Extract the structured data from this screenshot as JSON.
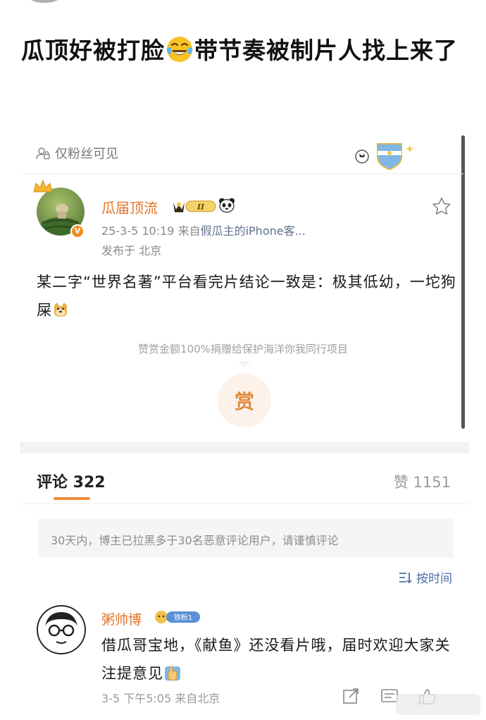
{
  "headline": {
    "part1": "瓜顶好被打脸",
    "emoji": "face-with-tears-of-joy",
    "part2": "带节奏被制片人找上来了"
  },
  "post": {
    "visibility": "仅粉丝可见",
    "author": {
      "name": "瓜届顶流",
      "vip_level": "II",
      "verified": true
    },
    "timestamp": "25-3-5 10:19",
    "source_prefix": "来自",
    "source_name": "假瓜主的iPhone客...",
    "location": "发布于 北京",
    "text": "某二字“世界名著”平台看完片结论一致是：极其低幼，一坨狗屎",
    "text_emoji": "doge",
    "reward_note": "赞赏金额100%捐赠给保护海洋你我同行项目",
    "reward_label": "赏"
  },
  "tabs": {
    "comments_label": "评论 322",
    "likes_label": "赞 1151"
  },
  "notice": "30天内，博主已拉黑多于30名恶意评论用户，请谨慎评论",
  "sort": {
    "label": "按时间",
    "icon": "sort-icon"
  },
  "comment": {
    "username": "粥帅博",
    "fan_badge": "铁粉1",
    "text": "借瓜哥宝地，《献鱼》还没看片哦，届时欢迎大家关注提意见",
    "text_emoji": "waving-hand",
    "time": "3-5 下午5:05",
    "location": "来自北京"
  },
  "colors": {
    "accent_orange": "#e5732a",
    "link_blue": "#4a6fa5",
    "tab_underline": "#f08c3a"
  }
}
